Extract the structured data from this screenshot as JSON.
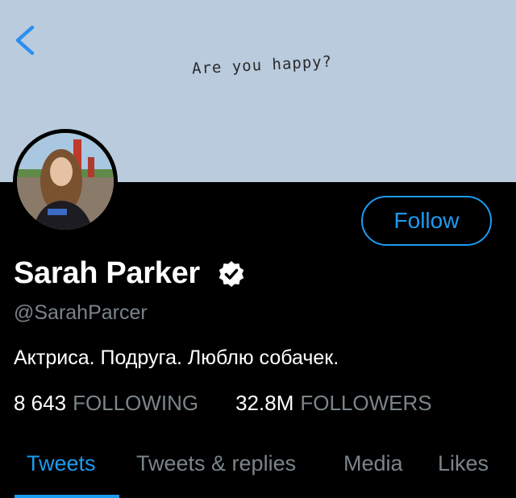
{
  "banner": {
    "text": "Are you happy?",
    "color": "#b9cbdd"
  },
  "nav": {
    "back_icon": "chevron-left-icon"
  },
  "profile": {
    "name": "Sarah Parker",
    "verified_icon": "verified-badge-icon",
    "handle": "@SarahParcer",
    "bio": "Актриса. Подруга. Люблю собачек.",
    "follow_label": "Follow"
  },
  "stats": {
    "following_count": "8 643",
    "following_label": "FOLLOWING",
    "followers_count": "32.8M",
    "followers_label": "FOLLOWERS"
  },
  "tabs": [
    {
      "label": "Tweets",
      "active": true
    },
    {
      "label": "Tweets & replies",
      "active": false
    },
    {
      "label": "Media",
      "active": false
    },
    {
      "label": "Likes",
      "active": false
    }
  ],
  "colors": {
    "accent": "#1d9bf0",
    "background": "#000000",
    "muted_text": "#7b8489"
  }
}
